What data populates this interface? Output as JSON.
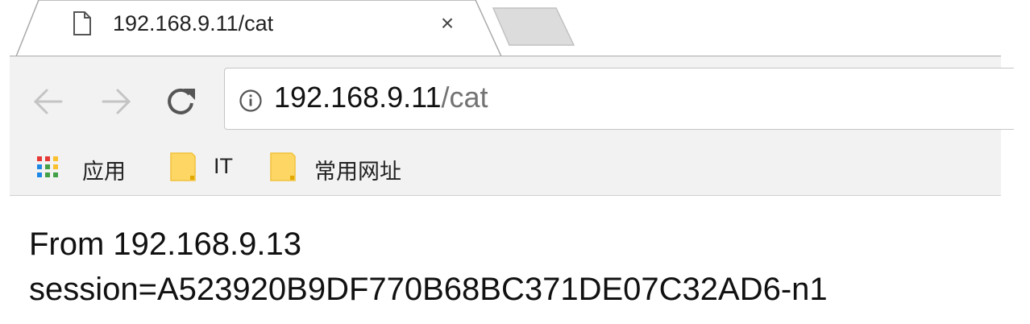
{
  "tab": {
    "title": "192.168.9.11/cat",
    "close_glyph": "×",
    "icon": "page-icon"
  },
  "toolbar": {
    "back_icon": "arrow-left-icon",
    "forward_icon": "arrow-right-icon",
    "reload_icon": "reload-icon",
    "url_host": "192.168.9.11",
    "url_path": "/cat",
    "info_icon": "info-icon"
  },
  "bookmarks": {
    "items": [
      {
        "label": "应用",
        "icon": "apps-grid-icon"
      },
      {
        "label": "IT",
        "icon": "folder-icon"
      },
      {
        "label": "常用网址",
        "icon": "folder-icon"
      }
    ]
  },
  "page": {
    "line1": "From 192.168.9.13",
    "line2": "session=A523920B9DF770B68BC371DE07C32AD6-n1"
  },
  "colors": {
    "toolbar_bg": "#f2f2f2",
    "folder_yellow": "#fdd663",
    "url_path_gray": "#737373"
  }
}
